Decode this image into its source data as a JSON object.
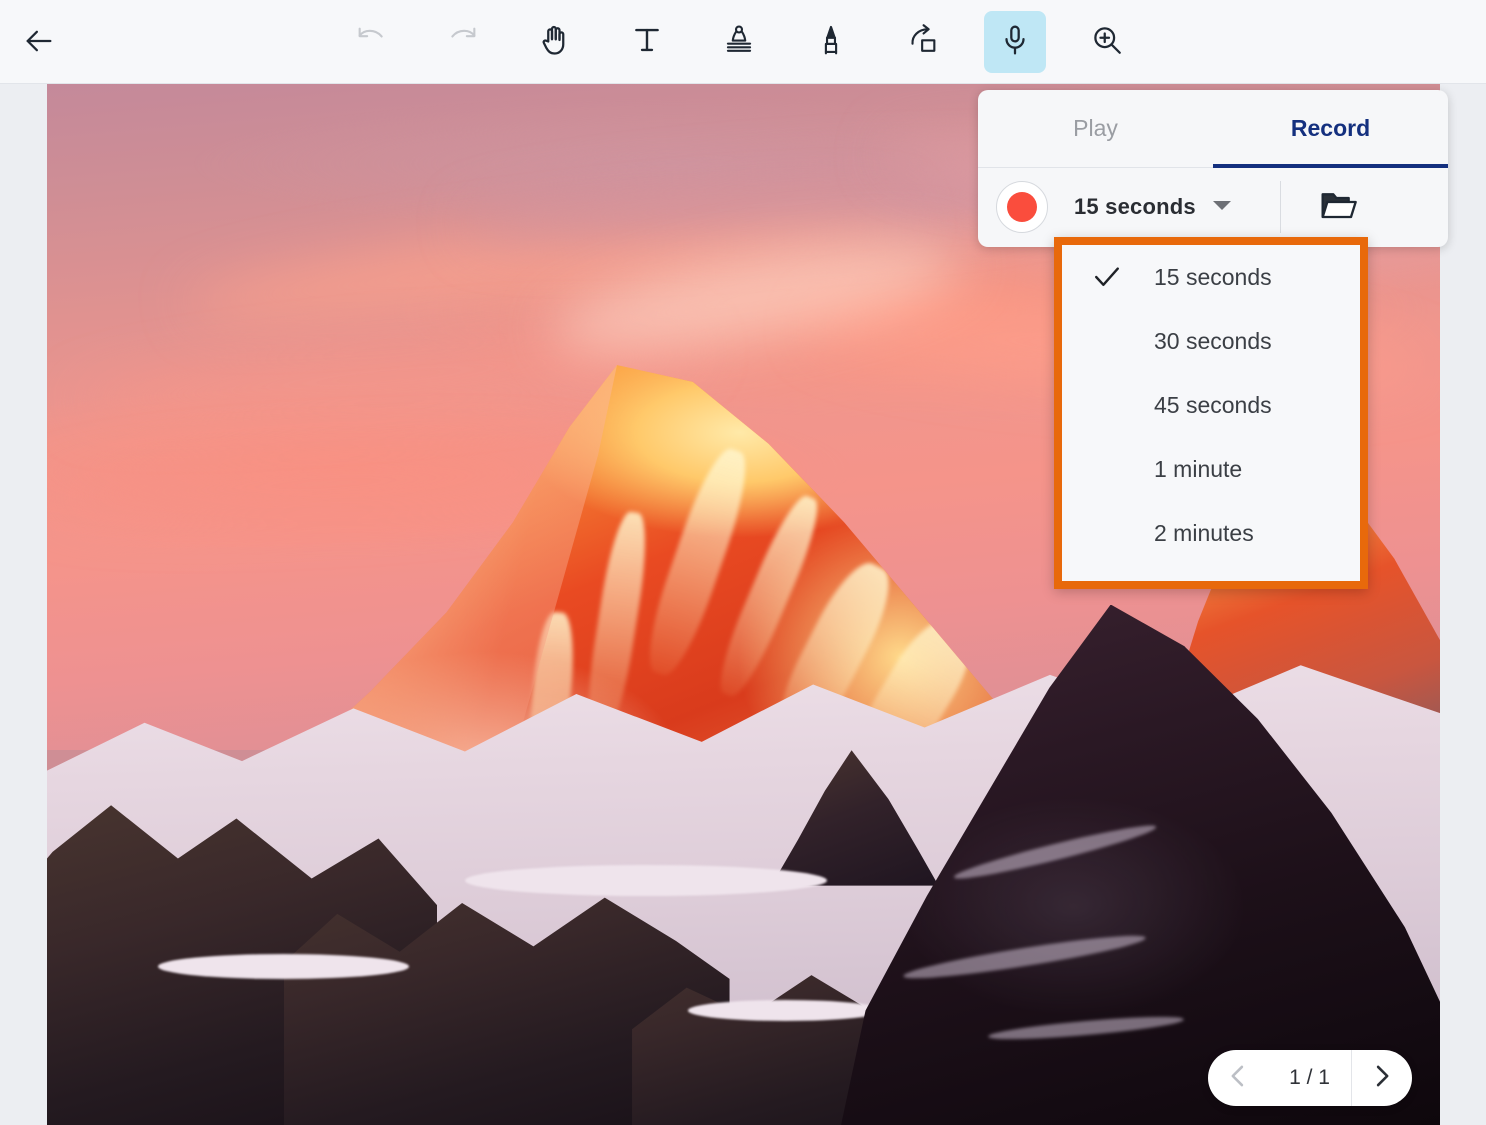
{
  "toolbar": {
    "back_label": "back-arrow",
    "tools": [
      {
        "name": "undo-tool",
        "icon": "undo-icon",
        "state": "disabled"
      },
      {
        "name": "redo-tool",
        "icon": "redo-icon",
        "state": "disabled"
      },
      {
        "name": "pan-tool",
        "icon": "hand-icon",
        "state": "normal"
      },
      {
        "name": "text-tool",
        "icon": "text-t-icon",
        "state": "normal"
      },
      {
        "name": "stamp-tool",
        "icon": "stamp-icon",
        "state": "normal"
      },
      {
        "name": "pen-tool",
        "icon": "marker-pen-icon",
        "state": "normal"
      },
      {
        "name": "share-tool",
        "icon": "share-arrow-icon",
        "state": "normal"
      },
      {
        "name": "audio-tool",
        "icon": "microphone-icon",
        "state": "active"
      },
      {
        "name": "zoom-tool",
        "icon": "magnifier-plus-icon",
        "state": "normal"
      }
    ]
  },
  "recorder": {
    "tabs": [
      {
        "label": "Play",
        "active": false
      },
      {
        "label": "Record",
        "active": true
      }
    ],
    "record_button": "record-dot",
    "duration_value": "15 seconds",
    "chevron": "chevron-down-icon",
    "browse_icon": "folder-icon"
  },
  "duration_menu": {
    "highlight_color": "#e8690b",
    "items": [
      {
        "label": "15 seconds",
        "checked": true
      },
      {
        "label": "30 seconds",
        "checked": false
      },
      {
        "label": "45 seconds",
        "checked": false
      },
      {
        "label": "1 minute",
        "checked": false
      },
      {
        "label": "2 minutes",
        "checked": false
      }
    ]
  },
  "page_nav": {
    "prev_icon": "chevron-left-icon",
    "next_icon": "chevron-right-icon",
    "counter": "1 / 1"
  },
  "canvas": {
    "image_description": "Mount Everest summit at sunset with pink sky and alpenglow on snow"
  },
  "colors": {
    "accent_navy": "#14307f",
    "record_red": "#fa4d3d",
    "highlight_orange": "#e8690b",
    "tool_active_bg": "#bfe7f5",
    "app_bg": "#eceef2"
  }
}
